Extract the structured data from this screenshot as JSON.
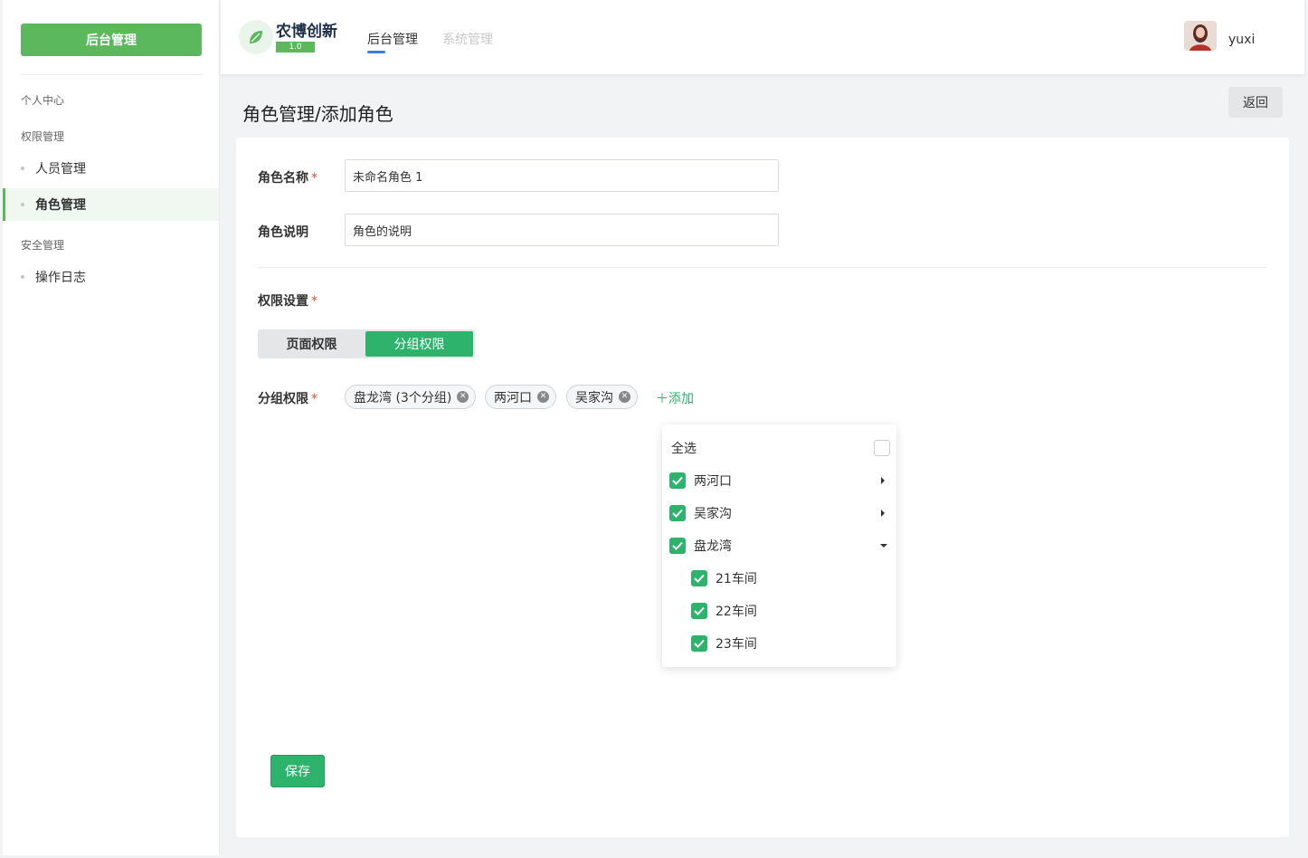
{
  "sidebar": {
    "top_button": "后台管理",
    "groups": [
      "个人中心",
      "权限管理",
      "安全管理"
    ],
    "items": [
      "人员管理",
      "角色管理",
      "操作日志"
    ]
  },
  "header": {
    "brand": "农博创新",
    "version": "1.0",
    "tabs": [
      "后台管理",
      "系统管理"
    ],
    "username": "yuxi"
  },
  "page": {
    "title": "角色管理/添加角色",
    "back": "返回"
  },
  "form": {
    "name_label": "角色名称",
    "name_value": "未命名角色 1",
    "desc_label": "角色说明",
    "desc_value": "角色的说明",
    "perm_label": "权限设置",
    "seg_page": "页面权限",
    "seg_group": "分组权限",
    "group_label": "分组权限",
    "tags": [
      "盘龙湾 (3个分组)",
      "两河口",
      "吴家沟"
    ],
    "add": "添加",
    "required_mark": "*"
  },
  "dropdown": {
    "select_all": "全选",
    "items": [
      "两河口",
      "吴家沟",
      "盘龙湾"
    ],
    "sub_items": [
      "21车间",
      "22车间",
      "23车间"
    ]
  },
  "save": "保存",
  "colors": {
    "primary": "#2db36c",
    "sidebar_green": "#5cb85c",
    "nav_indicator": "#3c7dde",
    "required": "#e74c3c"
  }
}
